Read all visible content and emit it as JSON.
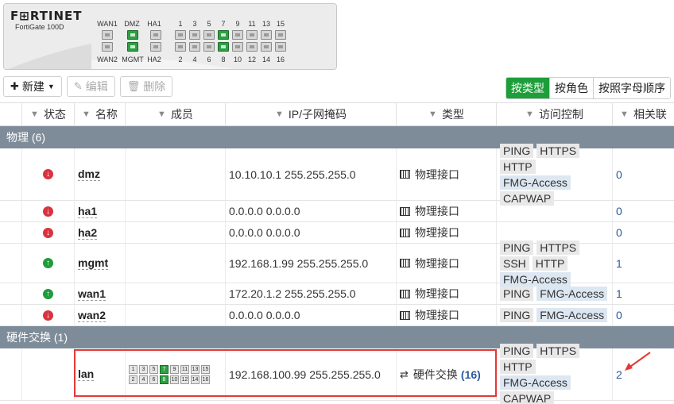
{
  "device": {
    "brand": "F⊞RTINET",
    "model": "FortiGate 100D",
    "top_labels": [
      "WAN1",
      "DMZ",
      "HA1",
      "1",
      "3",
      "5",
      "7",
      "9",
      "11",
      "13",
      "15"
    ],
    "bottom_labels": [
      "WAN2",
      "MGMT",
      "HA2",
      "2",
      "4",
      "6",
      "8",
      "10",
      "12",
      "14",
      "16"
    ]
  },
  "toolbar": {
    "new_label": "新建",
    "edit_label": "编辑",
    "delete_label": "删除"
  },
  "view_tabs": [
    "按类型",
    "按角色",
    "按照字母顺序"
  ],
  "columns": {
    "status": "状态",
    "name": "名称",
    "members": "成员",
    "ip": "IP/子网掩码",
    "type": "类型",
    "access": "访问控制",
    "ref": "相关联"
  },
  "groups": {
    "physical": "物理 (6)",
    "hwswitch": "硬件交换 (1)"
  },
  "rows": [
    {
      "status": "down",
      "name": "dmz",
      "ip": "10.10.10.1 255.255.255.0",
      "type": "物理接口",
      "access": [
        "PING",
        "HTTPS",
        "HTTP",
        "FMG-Access",
        "CAPWAP"
      ],
      "ref": "0"
    },
    {
      "status": "down",
      "name": "ha1",
      "ip": "0.0.0.0 0.0.0.0",
      "type": "物理接口",
      "access": [],
      "ref": "0"
    },
    {
      "status": "down",
      "name": "ha2",
      "ip": "0.0.0.0 0.0.0.0",
      "type": "物理接口",
      "access": [],
      "ref": "0"
    },
    {
      "status": "up",
      "name": "mgmt",
      "ip": "192.168.1.99 255.255.255.0",
      "type": "物理接口",
      "access": [
        "PING",
        "HTTPS",
        "SSH",
        "HTTP",
        "FMG-Access"
      ],
      "ref": "1"
    },
    {
      "status": "up",
      "name": "wan1",
      "ip": "172.20.1.2 255.255.255.0",
      "type": "物理接口",
      "access": [
        "PING",
        "FMG-Access"
      ],
      "ref": "1"
    },
    {
      "status": "down",
      "name": "wan2",
      "ip": "0.0.0.0 0.0.0.0",
      "type": "物理接口",
      "access": [
        "PING",
        "FMG-Access"
      ],
      "ref": "0"
    }
  ],
  "lan": {
    "name": "lan",
    "members_top": [
      "1",
      "3",
      "5",
      "7",
      "9",
      "11",
      "13",
      "15"
    ],
    "members_bottom": [
      "2",
      "4",
      "6",
      "8",
      "10",
      "12",
      "14",
      "16"
    ],
    "ip": "192.168.100.99 255.255.255.0",
    "type": "硬件交换",
    "type_count": "(16)",
    "access": [
      "PING",
      "HTTPS",
      "HTTP",
      "FMG-Access",
      "CAPWAP"
    ],
    "ref": "2"
  }
}
